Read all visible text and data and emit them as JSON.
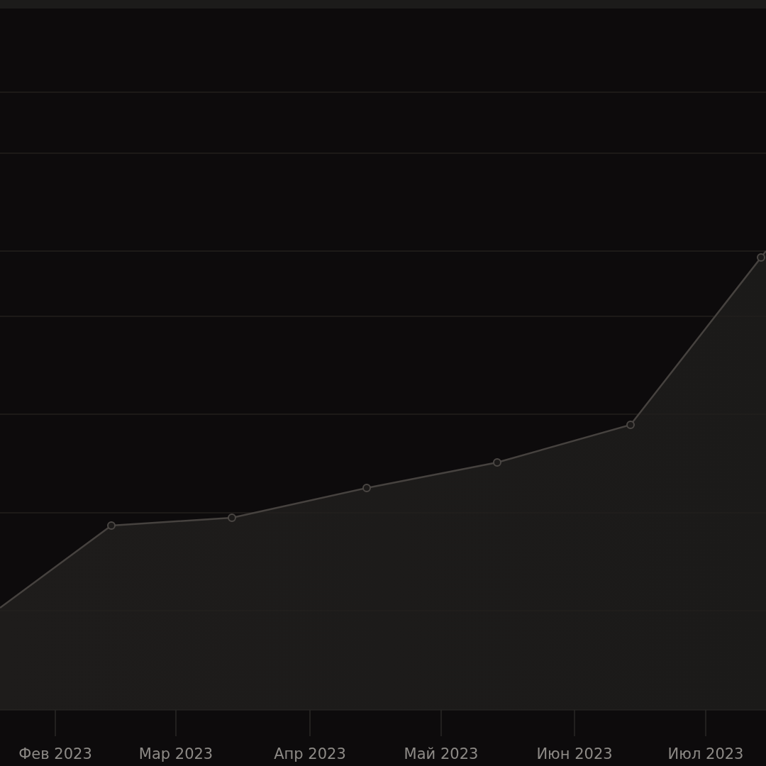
{
  "chart": {
    "x_axis_labels": [
      "Фев 2023",
      "Мар 2023",
      "Апр 2023",
      "Май 2023",
      "Июн 2023",
      "Июл 2023"
    ]
  }
}
